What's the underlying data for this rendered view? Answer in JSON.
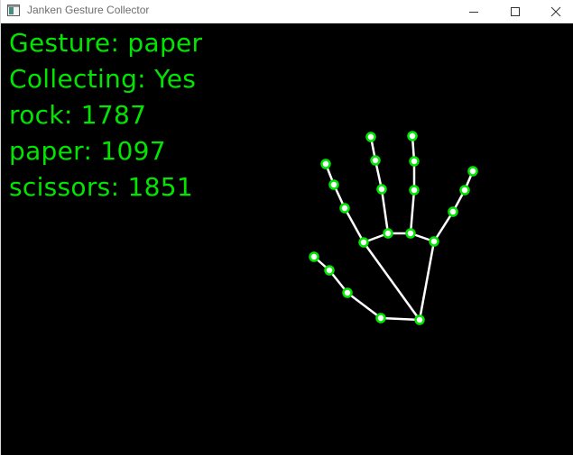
{
  "window": {
    "title": "Janken Gesture Collector",
    "controls": {
      "minimize": "minimize-icon",
      "maximize": "maximize-icon",
      "close": "close-icon"
    }
  },
  "overlay": {
    "gesture_label": "Gesture:",
    "gesture_value": "paper",
    "collecting_label": "Collecting:",
    "collecting_value": "Yes",
    "counts": [
      {
        "label": "rock:",
        "value": "1787"
      },
      {
        "label": "paper:",
        "value": "1097"
      },
      {
        "label": "scissors:",
        "value": "1851"
      }
    ]
  },
  "colors": {
    "text": "#00e600",
    "landmark": "#00e600",
    "connection": "#ffffff",
    "background": "#000000"
  }
}
